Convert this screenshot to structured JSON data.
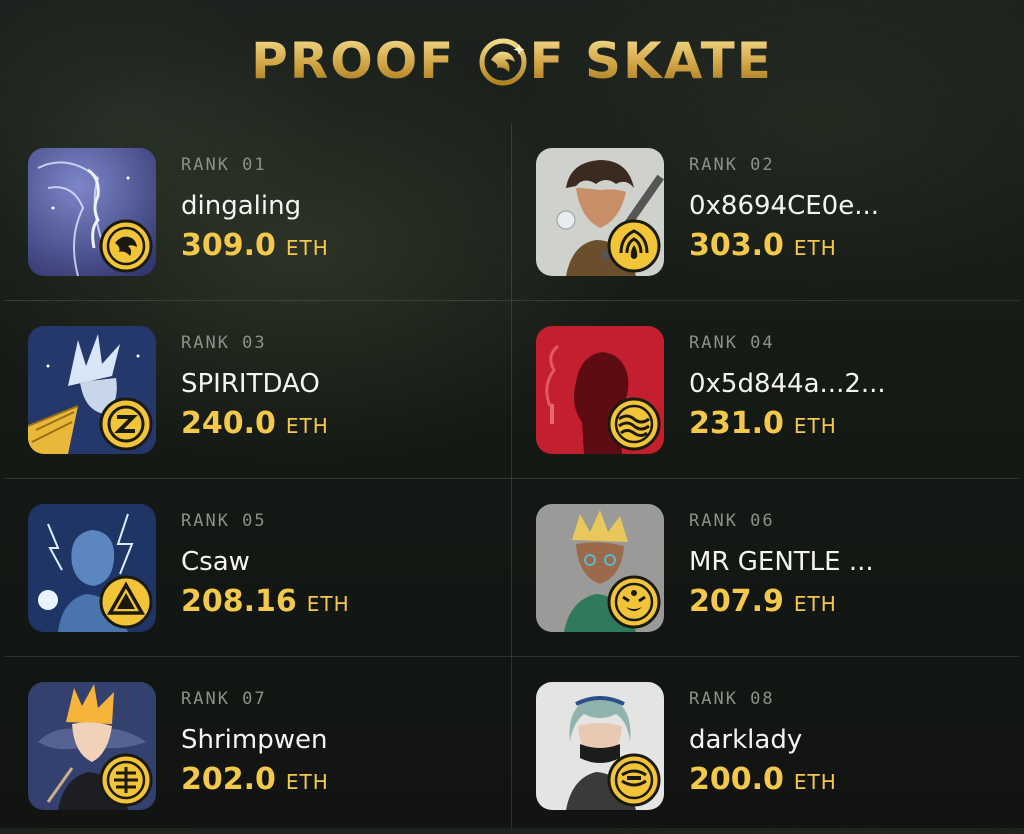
{
  "header": {
    "title_left": "PROOF",
    "title_logo": "skate-tiger-logo-icon",
    "title_right": "F SKATE"
  },
  "leaderboard": {
    "entries": [
      {
        "rank": "RANK 01",
        "name": "dingaling",
        "amount": "309.0",
        "unit": "ETH",
        "avatar_bg": "#4a4f8a",
        "badge_icon": "tiger-badge-icon"
      },
      {
        "rank": "RANK 02",
        "name": "0x8694CE0e...",
        "amount": "303.0",
        "unit": "ETH",
        "avatar_bg": "#cfd1cc",
        "badge_icon": "flame-badge-icon"
      },
      {
        "rank": "RANK 03",
        "name": "SPIRITDAO",
        "amount": "240.0",
        "unit": "ETH",
        "avatar_bg": "#2a3d6e",
        "badge_icon": "swirl-badge-icon"
      },
      {
        "rank": "RANK 04",
        "name": "0x5d844a...2...",
        "amount": "231.0",
        "unit": "ETH",
        "avatar_bg": "#c41f2e",
        "badge_icon": "waves-badge-icon"
      },
      {
        "rank": "RANK 05",
        "name": "Csaw",
        "amount": "208.16",
        "unit": "ETH",
        "avatar_bg": "#1f3566",
        "badge_icon": "triangle-badge-icon"
      },
      {
        "rank": "RANK 06",
        "name": "MR GENTLE ...",
        "amount": "207.9",
        "unit": "ETH",
        "avatar_bg": "#9a9b98",
        "badge_icon": "mask-badge-icon"
      },
      {
        "rank": "RANK 07",
        "name": "Shrimpwen",
        "amount": "202.0",
        "unit": "ETH",
        "avatar_bg": "#34406e",
        "badge_icon": "lion-badge-icon"
      },
      {
        "rank": "RANK 08",
        "name": "darklady",
        "amount": "200.0",
        "unit": "ETH",
        "avatar_bg": "#e4e4e2",
        "badge_icon": "sun-badge-icon"
      }
    ]
  },
  "colors": {
    "accent_gold": "#f4c84a",
    "rank_gray": "#8c9089",
    "background": "#151a15"
  }
}
